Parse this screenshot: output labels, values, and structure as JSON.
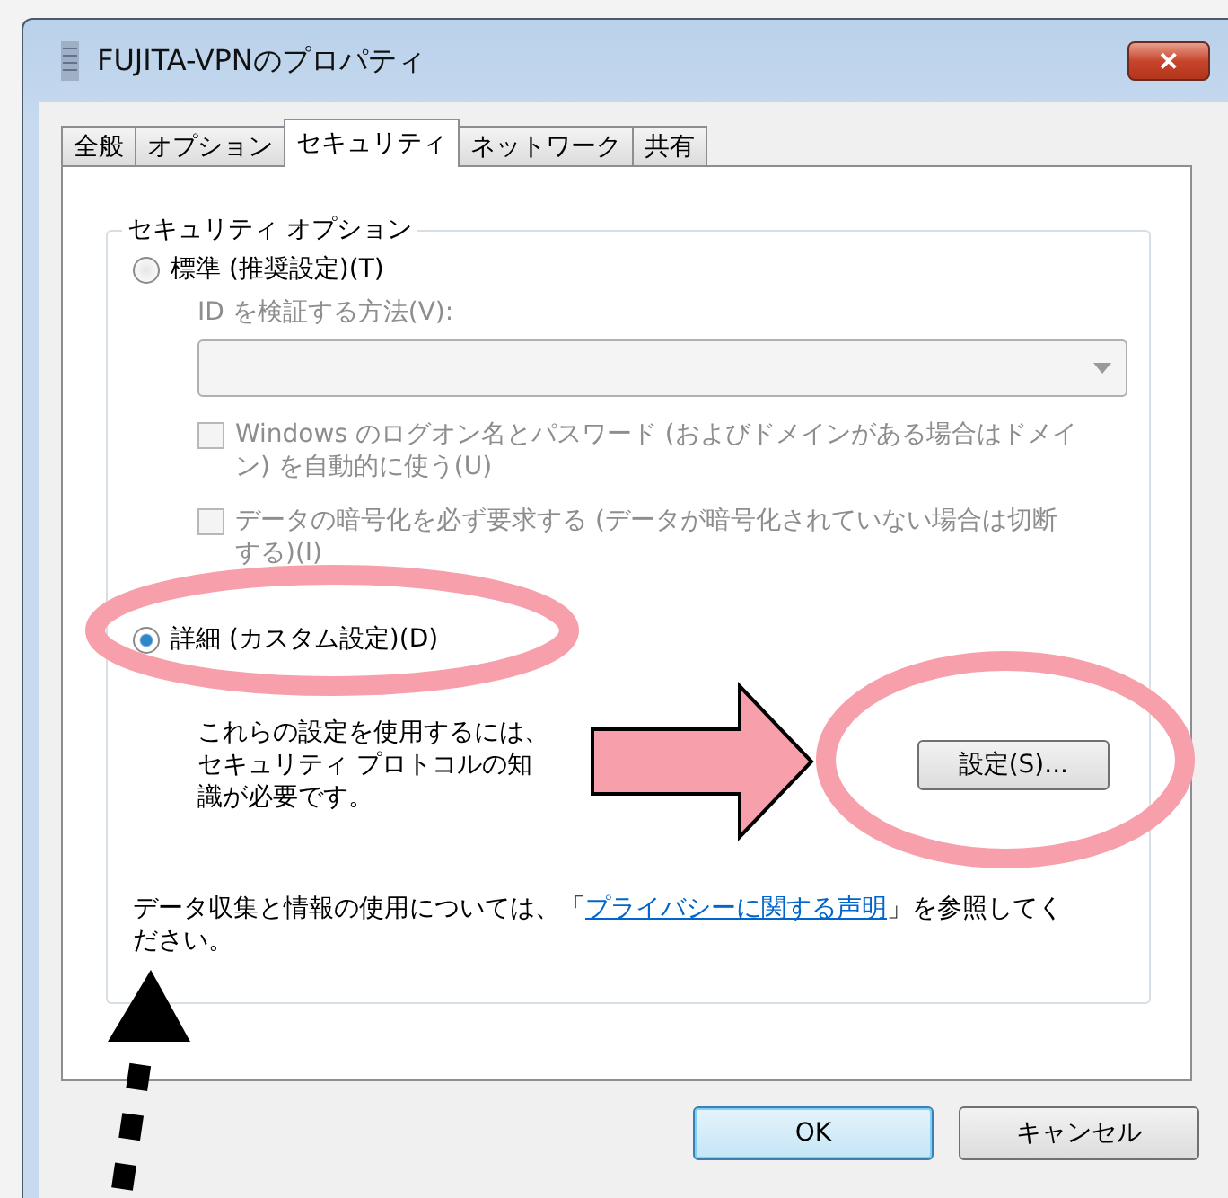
{
  "window": {
    "title": "FUJITA-VPNのプロパティ",
    "close": "✕"
  },
  "tabs": [
    {
      "label": "全般",
      "selected": false
    },
    {
      "label": "オプション",
      "selected": false
    },
    {
      "label": "セキュリティ",
      "selected": true
    },
    {
      "label": "ネットワーク",
      "selected": false
    },
    {
      "label": "共有",
      "selected": false
    }
  ],
  "security_options": {
    "title": "セキュリティ オプション",
    "items": [
      {
        "kind": "radio",
        "label": "標準 (推奨設定)(T)",
        "selected": false
      },
      {
        "kind": "label",
        "text": "ID を検証する方法(V):",
        "disabled": true
      },
      {
        "kind": "dropdown",
        "disabled": true
      },
      {
        "kind": "checkbox",
        "label": "Windows のログオン名とパスワード (およびドメインがある場合はドメイン) を自動的に使う(U)",
        "checked": false,
        "disabled": true
      },
      {
        "kind": "checkbox",
        "label": "データの暗号化を必ず要求する (データが暗号化されていない場合は切断する)(I)",
        "checked": false,
        "disabled": true
      },
      {
        "kind": "radio",
        "label": "詳細 (カスタム設定)(D)",
        "selected": true
      },
      {
        "kind": "note",
        "text": "これらの設定を使用するには、セキュリティ プロトコルの知識が必要です。",
        "button": "設定(S)..."
      }
    ],
    "privacy": {
      "before": "データ収集と情報の使用については、「",
      "link": "プライバシーに関する声明",
      "after": "」を参照してください。"
    }
  },
  "buttons": [
    {
      "label": "OK",
      "default": true
    },
    {
      "label": "キャンセル",
      "default": false
    }
  ]
}
